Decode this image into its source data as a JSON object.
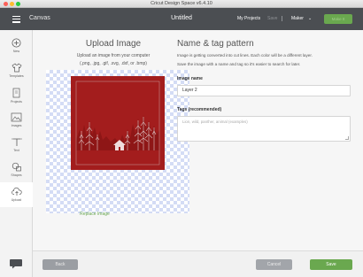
{
  "window": {
    "title": "Cricut Design Space  v6.4.10"
  },
  "header": {
    "app_name": "Canvas",
    "doc_title": "Untitled",
    "my_projects": "My Projects",
    "save": "Save",
    "machine": "Maker",
    "make_it": "Make It"
  },
  "sidebar": {
    "items": [
      {
        "label": "New",
        "icon": "plus-circle-icon"
      },
      {
        "label": "Templates",
        "icon": "shirt-icon"
      },
      {
        "label": "Projects",
        "icon": "projects-icon"
      },
      {
        "label": "Images",
        "icon": "images-icon"
      },
      {
        "label": "Text",
        "icon": "text-icon"
      },
      {
        "label": "Shapes",
        "icon": "shapes-icon"
      },
      {
        "label": "Upload",
        "icon": "upload-icon",
        "active": true
      }
    ],
    "chat_icon": "chat-bubble-icon"
  },
  "upload": {
    "title": "Upload Image",
    "subtitle1": "Upload an image from your computer",
    "subtitle2": "(.png, .jpg, .gif, .svg, .dxf, or .bmp)",
    "replace_label": "Replace Image",
    "art_color": "#a31d1d"
  },
  "tag_pattern": {
    "title": "Name & tag pattern",
    "desc1": "Image is getting converted into cut lines. Each color will be a different layer.",
    "desc2": "Save the image with a name and tag so it's easier to search for later.",
    "name_label": "Image name",
    "name_value": "Layer 2",
    "tags_label": "Tags (recommended)",
    "tags_placeholder": "Lion, wild, panther, animal (examples)"
  },
  "footer": {
    "back": "Back",
    "cancel": "Cancel",
    "save": "Save"
  },
  "colors": {
    "accent_green": "#6aa84f",
    "header_bg": "#4b4e52"
  }
}
